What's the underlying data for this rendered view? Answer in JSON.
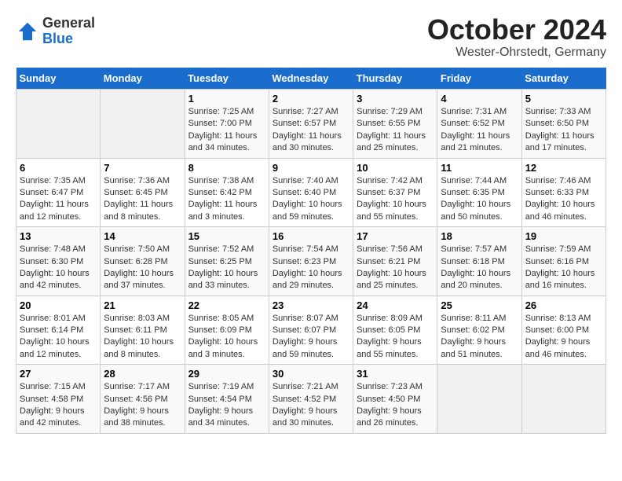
{
  "logo": {
    "general": "General",
    "blue": "Blue"
  },
  "title": "October 2024",
  "location": "Wester-Ohrstedt, Germany",
  "days_of_week": [
    "Sunday",
    "Monday",
    "Tuesday",
    "Wednesday",
    "Thursday",
    "Friday",
    "Saturday"
  ],
  "weeks": [
    [
      {
        "day": "",
        "info": ""
      },
      {
        "day": "",
        "info": ""
      },
      {
        "day": "1",
        "info": "Sunrise: 7:25 AM\nSunset: 7:00 PM\nDaylight: 11 hours\nand 34 minutes."
      },
      {
        "day": "2",
        "info": "Sunrise: 7:27 AM\nSunset: 6:57 PM\nDaylight: 11 hours\nand 30 minutes."
      },
      {
        "day": "3",
        "info": "Sunrise: 7:29 AM\nSunset: 6:55 PM\nDaylight: 11 hours\nand 25 minutes."
      },
      {
        "day": "4",
        "info": "Sunrise: 7:31 AM\nSunset: 6:52 PM\nDaylight: 11 hours\nand 21 minutes."
      },
      {
        "day": "5",
        "info": "Sunrise: 7:33 AM\nSunset: 6:50 PM\nDaylight: 11 hours\nand 17 minutes."
      }
    ],
    [
      {
        "day": "6",
        "info": "Sunrise: 7:35 AM\nSunset: 6:47 PM\nDaylight: 11 hours\nand 12 minutes."
      },
      {
        "day": "7",
        "info": "Sunrise: 7:36 AM\nSunset: 6:45 PM\nDaylight: 11 hours\nand 8 minutes."
      },
      {
        "day": "8",
        "info": "Sunrise: 7:38 AM\nSunset: 6:42 PM\nDaylight: 11 hours\nand 3 minutes."
      },
      {
        "day": "9",
        "info": "Sunrise: 7:40 AM\nSunset: 6:40 PM\nDaylight: 10 hours\nand 59 minutes."
      },
      {
        "day": "10",
        "info": "Sunrise: 7:42 AM\nSunset: 6:37 PM\nDaylight: 10 hours\nand 55 minutes."
      },
      {
        "day": "11",
        "info": "Sunrise: 7:44 AM\nSunset: 6:35 PM\nDaylight: 10 hours\nand 50 minutes."
      },
      {
        "day": "12",
        "info": "Sunrise: 7:46 AM\nSunset: 6:33 PM\nDaylight: 10 hours\nand 46 minutes."
      }
    ],
    [
      {
        "day": "13",
        "info": "Sunrise: 7:48 AM\nSunset: 6:30 PM\nDaylight: 10 hours\nand 42 minutes."
      },
      {
        "day": "14",
        "info": "Sunrise: 7:50 AM\nSunset: 6:28 PM\nDaylight: 10 hours\nand 37 minutes."
      },
      {
        "day": "15",
        "info": "Sunrise: 7:52 AM\nSunset: 6:25 PM\nDaylight: 10 hours\nand 33 minutes."
      },
      {
        "day": "16",
        "info": "Sunrise: 7:54 AM\nSunset: 6:23 PM\nDaylight: 10 hours\nand 29 minutes."
      },
      {
        "day": "17",
        "info": "Sunrise: 7:56 AM\nSunset: 6:21 PM\nDaylight: 10 hours\nand 25 minutes."
      },
      {
        "day": "18",
        "info": "Sunrise: 7:57 AM\nSunset: 6:18 PM\nDaylight: 10 hours\nand 20 minutes."
      },
      {
        "day": "19",
        "info": "Sunrise: 7:59 AM\nSunset: 6:16 PM\nDaylight: 10 hours\nand 16 minutes."
      }
    ],
    [
      {
        "day": "20",
        "info": "Sunrise: 8:01 AM\nSunset: 6:14 PM\nDaylight: 10 hours\nand 12 minutes."
      },
      {
        "day": "21",
        "info": "Sunrise: 8:03 AM\nSunset: 6:11 PM\nDaylight: 10 hours\nand 8 minutes."
      },
      {
        "day": "22",
        "info": "Sunrise: 8:05 AM\nSunset: 6:09 PM\nDaylight: 10 hours\nand 3 minutes."
      },
      {
        "day": "23",
        "info": "Sunrise: 8:07 AM\nSunset: 6:07 PM\nDaylight: 9 hours\nand 59 minutes."
      },
      {
        "day": "24",
        "info": "Sunrise: 8:09 AM\nSunset: 6:05 PM\nDaylight: 9 hours\nand 55 minutes."
      },
      {
        "day": "25",
        "info": "Sunrise: 8:11 AM\nSunset: 6:02 PM\nDaylight: 9 hours\nand 51 minutes."
      },
      {
        "day": "26",
        "info": "Sunrise: 8:13 AM\nSunset: 6:00 PM\nDaylight: 9 hours\nand 46 minutes."
      }
    ],
    [
      {
        "day": "27",
        "info": "Sunrise: 7:15 AM\nSunset: 4:58 PM\nDaylight: 9 hours\nand 42 minutes."
      },
      {
        "day": "28",
        "info": "Sunrise: 7:17 AM\nSunset: 4:56 PM\nDaylight: 9 hours\nand 38 minutes."
      },
      {
        "day": "29",
        "info": "Sunrise: 7:19 AM\nSunset: 4:54 PM\nDaylight: 9 hours\nand 34 minutes."
      },
      {
        "day": "30",
        "info": "Sunrise: 7:21 AM\nSunset: 4:52 PM\nDaylight: 9 hours\nand 30 minutes."
      },
      {
        "day": "31",
        "info": "Sunrise: 7:23 AM\nSunset: 4:50 PM\nDaylight: 9 hours\nand 26 minutes."
      },
      {
        "day": "",
        "info": ""
      },
      {
        "day": "",
        "info": ""
      }
    ]
  ]
}
